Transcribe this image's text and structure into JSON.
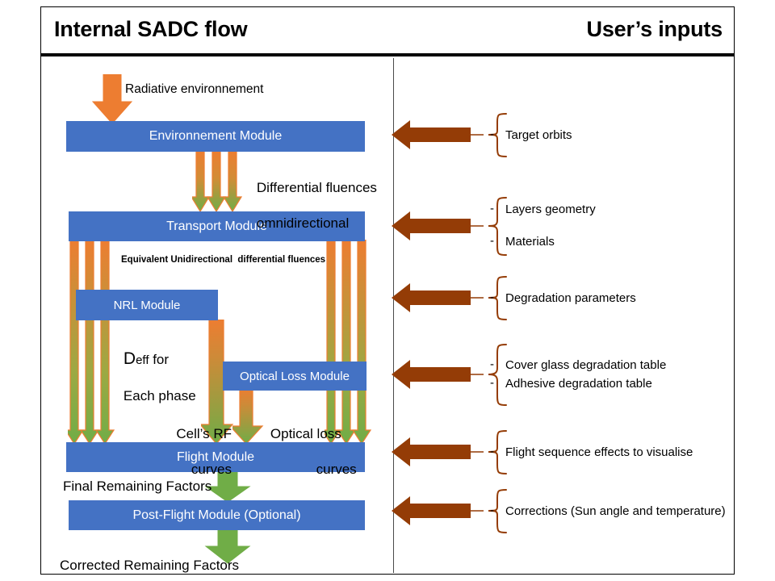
{
  "header": {
    "left_title": "Internal SADC flow",
    "right_title": "User’s inputs"
  },
  "colors": {
    "module_blue": "#4472C4",
    "arrow_orange": "#ED7D31",
    "arrow_green": "#70AD47",
    "input_brown": "#943C06",
    "text_black": "#000000"
  },
  "flow": {
    "top_input_label": "Radiative environnement",
    "modules": [
      {
        "id": "environment",
        "label": "Environnement Module"
      },
      {
        "id": "transport",
        "label": "Transport Module"
      },
      {
        "id": "nrl",
        "label": "NRL Module"
      },
      {
        "id": "optical_loss",
        "label": "Optical Loss Module"
      },
      {
        "id": "flight",
        "label": "Flight Module"
      },
      {
        "id": "post_flight",
        "label": "Post-Flight Module (Optional)"
      }
    ],
    "edge_labels": {
      "env_to_transport_line1": "Differential fluences",
      "env_to_transport_line2": "omnidirectional",
      "transport_out": "Equivalent Unidirectional  differential fluences",
      "nrl_out_prefix": "D",
      "nrl_out_sub": "eff",
      "nrl_out_rest": " for",
      "nrl_out_line2": "Each phase",
      "nrl_to_flight_line1": "Cell’s RF",
      "nrl_to_flight_line2": "curves",
      "optical_to_flight_line1": "Optical loss",
      "optical_to_flight_line2": "curves",
      "flight_out": "Final Remaining Factors",
      "post_flight_out": "Corrected Remaining Factors"
    }
  },
  "inputs": [
    {
      "id": "target-orbits",
      "items": [
        "Target orbits"
      ]
    },
    {
      "id": "layers-materials",
      "items": [
        "Layers geometry",
        "Materials"
      ]
    },
    {
      "id": "degradation-params",
      "items": [
        "Degradation parameters"
      ]
    },
    {
      "id": "degradation-tables",
      "items": [
        "Cover glass degradation table",
        "Adhesive degradation table"
      ]
    },
    {
      "id": "flight-sequence",
      "items": [
        "Flight sequence effects to visualise"
      ]
    },
    {
      "id": "corrections",
      "items": [
        "Corrections (Sun angle and temperature)"
      ]
    }
  ],
  "bullet": "-"
}
